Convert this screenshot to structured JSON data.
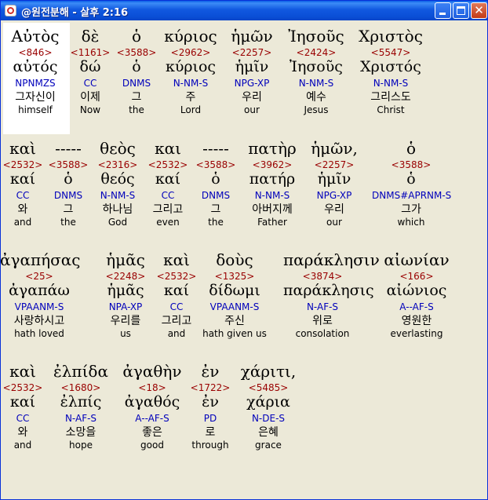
{
  "window": {
    "title": "@원전분해 - 살후 2:16"
  },
  "rows": [
    [
      {
        "word": "Αὐτὸς",
        "num": "<846>",
        "lemma": "αὐτός",
        "parse": "NPNMZS",
        "korean": "그자신이",
        "english": "himself"
      },
      {
        "word": "δὲ",
        "num": "<1161>",
        "lemma": "δώ",
        "parse": "CC",
        "korean": "이제",
        "english": "Now"
      },
      {
        "word": "ὁ",
        "num": "<3588>",
        "lemma": "ὁ",
        "parse": "DNMS",
        "korean": "그",
        "english": "the"
      },
      {
        "word": "κύριος",
        "num": "<2962>",
        "lemma": "κύριος",
        "parse": "N-NM-S",
        "korean": "주",
        "english": "Lord"
      },
      {
        "word": "ἡμῶν",
        "num": "<2257>",
        "lemma": "ἡμῖν",
        "parse": "NPG-XP",
        "korean": "우리",
        "english": "our"
      },
      {
        "word": "Ἰησοῦς",
        "num": "<2424>",
        "lemma": "Ἰησοῦς",
        "parse": "N-NM-S",
        "korean": "예수",
        "english": "Jesus"
      },
      {
        "word": "Χριστὸς",
        "num": "<5547>",
        "lemma": "Χριστός",
        "parse": "N-NM-S",
        "korean": "그리스도",
        "english": "Christ"
      }
    ],
    [
      {
        "word": "καὶ",
        "num": "<2532>",
        "lemma": "καί",
        "parse": "CC",
        "korean": "와",
        "english": "and"
      },
      {
        "word": "-----",
        "num": "<3588>",
        "lemma": "ὁ",
        "parse": "DNMS",
        "korean": "그",
        "english": "the"
      },
      {
        "word": "θεὸς",
        "num": "<2316>",
        "lemma": "θεός",
        "parse": "N-NM-S",
        "korean": "하나님",
        "english": "God"
      },
      {
        "word": "και",
        "num": "<2532>",
        "lemma": "καί",
        "parse": "CC",
        "korean": "그리고",
        "english": "even"
      },
      {
        "word": "-----",
        "num": "<3588>",
        "lemma": "ὁ",
        "parse": "DNMS",
        "korean": "그",
        "english": "the"
      },
      {
        "word": "πατὴρ",
        "num": "<3962>",
        "lemma": "πατήρ",
        "parse": "N-NM-S",
        "korean": "아버지께",
        "english": "Father"
      },
      {
        "word": "ἡμῶν,",
        "num": "<2257>",
        "lemma": "ἡμῖν",
        "parse": "NPG-XP",
        "korean": "우리",
        "english": "our"
      },
      {
        "word": "ὁ",
        "num": "<3588>",
        "lemma": "ὁ",
        "parse": "DNMS#APRNM-S",
        "korean": "그가",
        "english": "which"
      }
    ],
    [
      {
        "word": "ἀγαπήσας",
        "num": "<25>",
        "lemma": "ἀγαπάω",
        "parse": "VPAANM-S",
        "korean": "사랑하시고",
        "english": "hath loved"
      },
      {
        "word": "ἡμᾶς",
        "num": "<2248>",
        "lemma": "ἡμᾶς",
        "parse": "NPA-XP",
        "korean": "우리를",
        "english": "us"
      },
      {
        "word": "καὶ",
        "num": "<2532>",
        "lemma": "καί",
        "parse": "CC",
        "korean": "그리고",
        "english": "and"
      },
      {
        "word": "δοὺς",
        "num": "<1325>",
        "lemma": "δίδωμι",
        "parse": "VPAANM-S",
        "korean": "주신",
        "english": "hath given us"
      },
      {
        "word": "παράκλησιν",
        "num": "<3874>",
        "lemma": "παράκλησις",
        "parse": "N-AF-S",
        "korean": "위로",
        "english": "consolation"
      },
      {
        "word": "αἰωνίαν",
        "num": "<166>",
        "lemma": "αἰώνιος",
        "parse": "A--AF-S",
        "korean": "영원한",
        "english": "everlasting"
      }
    ],
    [
      {
        "word": "καὶ",
        "num": "<2532>",
        "lemma": "καί",
        "parse": "CC",
        "korean": "와",
        "english": "and"
      },
      {
        "word": "ἐλπίδα",
        "num": "<1680>",
        "lemma": "ἐλπίς",
        "parse": "N-AF-S",
        "korean": "소망을",
        "english": "hope"
      },
      {
        "word": "ἀγαθὴν",
        "num": "<18>",
        "lemma": "ἀγαθός",
        "parse": "A--AF-S",
        "korean": "좋은",
        "english": "good"
      },
      {
        "word": "ἐν",
        "num": "<1722>",
        "lemma": "ἐν",
        "parse": "PD",
        "korean": "로",
        "english": "through"
      },
      {
        "word": "χάριτι,",
        "num": "<5485>",
        "lemma": "χάρια",
        "parse": "N-DE-S",
        "korean": "은혜",
        "english": "grace"
      }
    ]
  ]
}
